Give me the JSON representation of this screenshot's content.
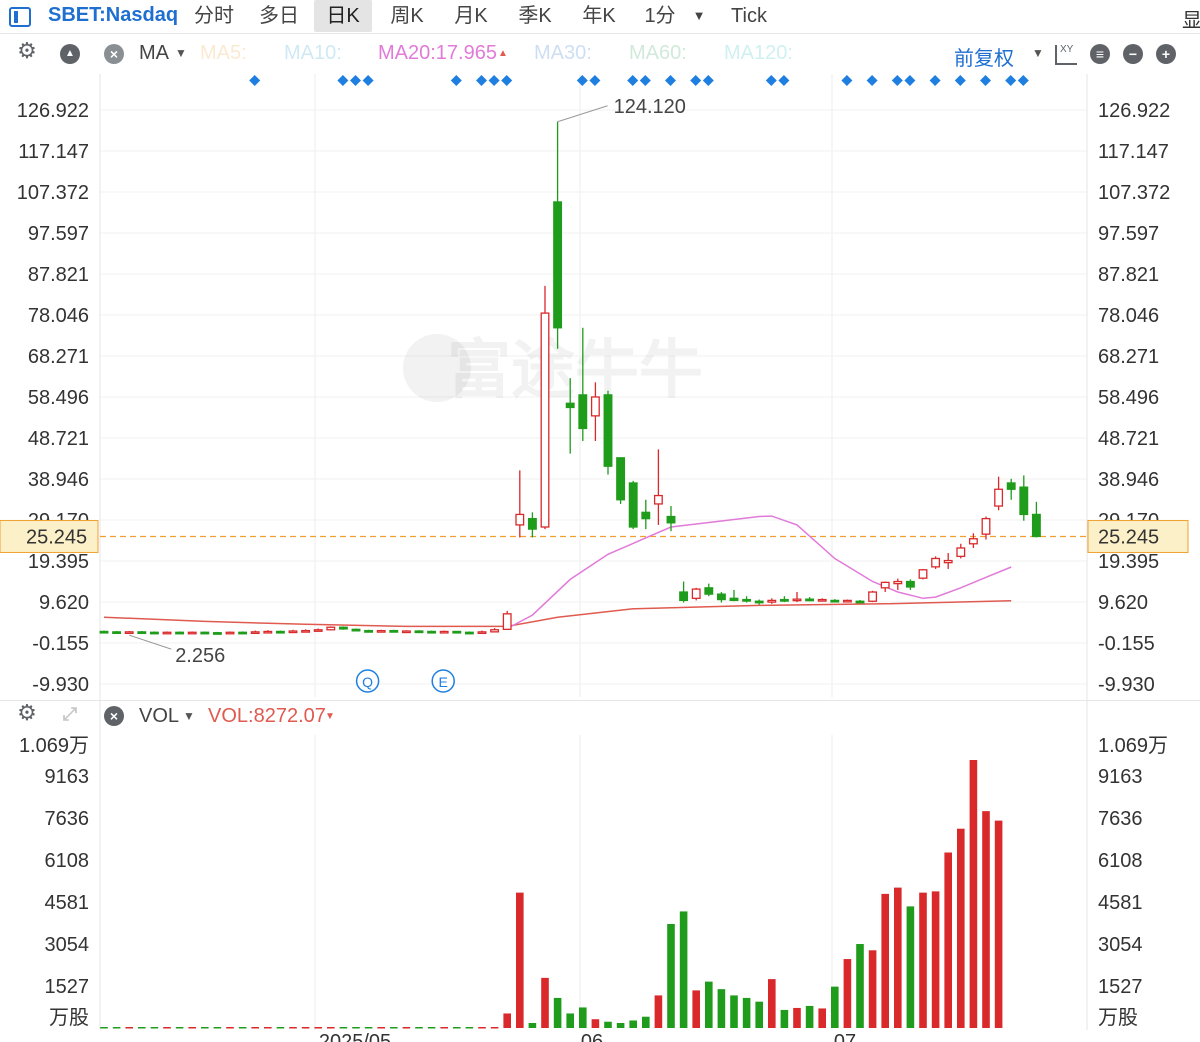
{
  "toolbar": {
    "ticker": "SBET:Nasdaq",
    "tabs": [
      "分时",
      "多日",
      "日K",
      "周K",
      "月K",
      "季K",
      "年K",
      "1分",
      "Tick"
    ],
    "active_tab": "日K",
    "right_cut": "显"
  },
  "ma_bar": {
    "indicator": "MA",
    "ma5": "MA5:",
    "ma10": "MA10:",
    "ma20": "MA20:17.965",
    "ma30": "MA30:",
    "ma60": "MA60:",
    "ma120": "MA120:",
    "adjust": "前复权",
    "xy_label": "XY"
  },
  "vol_bar": {
    "indicator": "VOL",
    "value": "VOL:8272.07"
  },
  "watermark": "富途牛牛",
  "colors": {
    "up": "#d9292b",
    "down": "#1f9c1b",
    "ma20": "#e27ad9",
    "ma_long": "#e05a4f",
    "accent": "#1f6fd1",
    "current": "#f0a030",
    "current_bg": "#fbf0c8",
    "marker": "#1e7fe0"
  },
  "chart_data": [
    {
      "type": "candlestick",
      "title": "SBET:Nasdaq 日K",
      "y_ticks": [
        "126.922",
        "117.147",
        "107.372",
        "97.597",
        "87.821",
        "78.046",
        "68.271",
        "58.496",
        "48.721",
        "38.946",
        "29.170",
        "19.395",
        "9.620",
        "-0.155",
        "-9.930"
      ],
      "ylim": [
        -9.93,
        126.922
      ],
      "x_labels": [
        "2025/05",
        "06",
        "07"
      ],
      "current_price": "25.245",
      "high_label": "124.120",
      "low_label": "2.256",
      "event_markers": [
        "Q",
        "E"
      ],
      "candles": [
        {
          "o": 2.6,
          "c": 2.5,
          "h": 2.8,
          "l": 2.3
        },
        {
          "o": 2.5,
          "c": 2.4,
          "h": 2.7,
          "l": 2.3
        },
        {
          "o": 2.4,
          "c": 2.5,
          "h": 2.7,
          "l": 2.2
        },
        {
          "o": 2.5,
          "c": 2.4,
          "h": 2.7,
          "l": 2.3
        },
        {
          "o": 2.4,
          "c": 2.3,
          "h": 2.6,
          "l": 2.2
        },
        {
          "o": 2.3,
          "c": 2.4,
          "h": 2.6,
          "l": 2.2
        },
        {
          "o": 2.4,
          "c": 2.3,
          "h": 2.6,
          "l": 2.2
        },
        {
          "o": 2.3,
          "c": 2.4,
          "h": 2.6,
          "l": 2.2
        },
        {
          "o": 2.4,
          "c": 2.3,
          "h": 2.6,
          "l": 2.2
        },
        {
          "o": 2.3,
          "c": 2.256,
          "h": 2.5,
          "l": 2.256
        },
        {
          "o": 2.3,
          "c": 2.4,
          "h": 2.6,
          "l": 2.2
        },
        {
          "o": 2.4,
          "c": 2.3,
          "h": 2.6,
          "l": 2.2
        },
        {
          "o": 2.3,
          "c": 2.5,
          "h": 2.8,
          "l": 2.2
        },
        {
          "o": 2.5,
          "c": 2.6,
          "h": 2.9,
          "l": 2.4
        },
        {
          "o": 2.6,
          "c": 2.5,
          "h": 2.8,
          "l": 2.4
        },
        {
          "o": 2.5,
          "c": 2.7,
          "h": 3.0,
          "l": 2.4
        },
        {
          "o": 2.7,
          "c": 2.8,
          "h": 3.1,
          "l": 2.5
        },
        {
          "o": 2.8,
          "c": 3.0,
          "h": 3.3,
          "l": 2.6
        },
        {
          "o": 3.0,
          "c": 3.6,
          "h": 3.8,
          "l": 2.9
        },
        {
          "o": 3.6,
          "c": 3.2,
          "h": 3.8,
          "l": 3.0
        },
        {
          "o": 3.1,
          "c": 2.8,
          "h": 3.3,
          "l": 2.7
        },
        {
          "o": 2.8,
          "c": 2.6,
          "h": 3.0,
          "l": 2.5
        },
        {
          "o": 2.6,
          "c": 2.8,
          "h": 3.0,
          "l": 2.5
        },
        {
          "o": 2.8,
          "c": 2.6,
          "h": 3.0,
          "l": 2.5
        },
        {
          "o": 2.6,
          "c": 2.7,
          "h": 2.9,
          "l": 2.5
        },
        {
          "o": 2.7,
          "c": 2.6,
          "h": 2.9,
          "l": 2.5
        },
        {
          "o": 2.6,
          "c": 2.5,
          "h": 2.8,
          "l": 2.4
        },
        {
          "o": 2.5,
          "c": 2.6,
          "h": 2.8,
          "l": 2.4
        },
        {
          "o": 2.6,
          "c": 2.4,
          "h": 2.7,
          "l": 2.3
        },
        {
          "o": 2.4,
          "c": 2.3,
          "h": 2.6,
          "l": 2.2
        },
        {
          "o": 2.3,
          "c": 2.5,
          "h": 2.8,
          "l": 2.2
        },
        {
          "o": 2.5,
          "c": 3.0,
          "h": 3.4,
          "l": 2.4
        },
        {
          "o": 3.1,
          "c": 6.8,
          "h": 7.5,
          "l": 3.0
        },
        {
          "o": 28.0,
          "c": 30.5,
          "h": 41.0,
          "l": 25.0
        },
        {
          "o": 29.5,
          "c": 27.0,
          "h": 31.0,
          "l": 25.0
        },
        {
          "o": 27.5,
          "c": 78.5,
          "h": 85.0,
          "l": 27.0
        },
        {
          "o": 105.0,
          "c": 75.0,
          "h": 124.12,
          "l": 70.0
        },
        {
          "o": 57.0,
          "c": 56.0,
          "h": 63.0,
          "l": 45.0
        },
        {
          "o": 59.0,
          "c": 51.0,
          "h": 75.0,
          "l": 48.0
        },
        {
          "o": 54.0,
          "c": 58.5,
          "h": 62.0,
          "l": 48.0
        },
        {
          "o": 59.0,
          "c": 42.0,
          "h": 60.0,
          "l": 40.0
        },
        {
          "o": 44.0,
          "c": 34.0,
          "h": 43.5,
          "l": 33.0
        },
        {
          "o": 38.0,
          "c": 27.5,
          "h": 38.5,
          "l": 27.0
        },
        {
          "o": 31.0,
          "c": 29.5,
          "h": 34.0,
          "l": 27.0
        },
        {
          "o": 33.0,
          "c": 35.0,
          "h": 46.0,
          "l": 28.0
        },
        {
          "o": 30.0,
          "c": 28.5,
          "h": 32.5,
          "l": 26.5
        },
        {
          "o": 12.0,
          "c": 10.0,
          "h": 14.5,
          "l": 9.5
        },
        {
          "o": 10.5,
          "c": 12.7,
          "h": 13.0,
          "l": 10.0
        },
        {
          "o": 13.0,
          "c": 11.5,
          "h": 14.0,
          "l": 11.0
        },
        {
          "o": 11.5,
          "c": 10.2,
          "h": 12.0,
          "l": 9.5
        },
        {
          "o": 10.5,
          "c": 10.0,
          "h": 12.5,
          "l": 9.8
        },
        {
          "o": 10.2,
          "c": 10.0,
          "h": 11.0,
          "l": 9.5
        },
        {
          "o": 9.8,
          "c": 9.5,
          "h": 10.2,
          "l": 9.0
        },
        {
          "o": 9.6,
          "c": 10.0,
          "h": 10.5,
          "l": 9.2
        },
        {
          "o": 10.2,
          "c": 10.0,
          "h": 11.0,
          "l": 9.6
        },
        {
          "o": 10.0,
          "c": 10.3,
          "h": 12.0,
          "l": 9.6
        },
        {
          "o": 10.3,
          "c": 10.0,
          "h": 10.8,
          "l": 9.8
        },
        {
          "o": 10.0,
          "c": 10.2,
          "h": 10.5,
          "l": 9.8
        },
        {
          "o": 10.0,
          "c": 9.9,
          "h": 10.3,
          "l": 9.6
        },
        {
          "o": 9.9,
          "c": 10.0,
          "h": 10.2,
          "l": 9.7
        },
        {
          "o": 9.8,
          "c": 9.7,
          "h": 10.1,
          "l": 9.5
        },
        {
          "o": 9.8,
          "c": 12.0,
          "h": 12.3,
          "l": 9.6
        },
        {
          "o": 13.0,
          "c": 14.3,
          "h": 14.5,
          "l": 12.0
        },
        {
          "o": 14.0,
          "c": 14.5,
          "h": 15.2,
          "l": 12.5
        },
        {
          "o": 14.5,
          "c": 13.2,
          "h": 15.0,
          "l": 12.5
        },
        {
          "o": 15.3,
          "c": 17.3,
          "h": 17.5,
          "l": 15.0
        },
        {
          "o": 18.0,
          "c": 20.0,
          "h": 20.5,
          "l": 17.5
        },
        {
          "o": 19.0,
          "c": 19.5,
          "h": 21.3,
          "l": 17.5
        },
        {
          "o": 20.5,
          "c": 22.5,
          "h": 23.5,
          "l": 20.0
        },
        {
          "o": 23.5,
          "c": 24.7,
          "h": 26.0,
          "l": 22.5
        },
        {
          "o": 25.8,
          "c": 29.5,
          "h": 30.0,
          "l": 24.5
        },
        {
          "o": 32.5,
          "c": 36.5,
          "h": 39.5,
          "l": 31.5
        },
        {
          "o": 38.0,
          "c": 36.5,
          "h": 39.0,
          "l": 34.0
        },
        {
          "o": 37.0,
          "c": 30.5,
          "h": 39.8,
          "l": 29.0
        },
        {
          "o": 30.5,
          "c": 25.245,
          "h": 33.5,
          "l": 25.0
        }
      ],
      "ma20": [
        {
          "i": 32,
          "v": 3.3
        },
        {
          "i": 34,
          "v": 6.5
        },
        {
          "i": 37,
          "v": 15.0
        },
        {
          "i": 40,
          "v": 21.0
        },
        {
          "i": 45,
          "v": 27.5
        },
        {
          "i": 52,
          "v": 30.0
        },
        {
          "i": 53,
          "v": 30.1
        },
        {
          "i": 55,
          "v": 28.0
        },
        {
          "i": 58,
          "v": 20.0
        },
        {
          "i": 61,
          "v": 14.5
        },
        {
          "i": 63,
          "v": 12.0
        },
        {
          "i": 65,
          "v": 10.5
        },
        {
          "i": 66,
          "v": 10.8
        },
        {
          "i": 68,
          "v": 13.0
        },
        {
          "i": 70,
          "v": 15.5
        },
        {
          "i": 72,
          "v": 17.965
        }
      ],
      "ma_long": [
        {
          "i": 0,
          "v": 6.0
        },
        {
          "i": 8,
          "v": 5.0
        },
        {
          "i": 16,
          "v": 4.3
        },
        {
          "i": 24,
          "v": 3.8
        },
        {
          "i": 32,
          "v": 3.8
        },
        {
          "i": 36,
          "v": 6.0
        },
        {
          "i": 42,
          "v": 8.0
        },
        {
          "i": 52,
          "v": 8.8
        },
        {
          "i": 62,
          "v": 9.2
        },
        {
          "i": 72,
          "v": 9.9
        }
      ]
    },
    {
      "type": "bar",
      "title": "VOL",
      "ylabel": "万股",
      "y_ticks": [
        "1.069万",
        "9163",
        "7636",
        "6108",
        "4581",
        "3054",
        "1527",
        "万股"
      ],
      "ylim": [
        0,
        10690
      ],
      "values": [
        40,
        40,
        40,
        40,
        40,
        40,
        40,
        40,
        40,
        40,
        40,
        40,
        40,
        40,
        40,
        40,
        40,
        40,
        40,
        40,
        40,
        40,
        40,
        40,
        40,
        40,
        40,
        40,
        40,
        40,
        40,
        40,
        580,
        5400,
        200,
        2000,
        1200,
        580,
        820,
        350,
        250,
        200,
        300,
        450,
        1300,
        4150,
        4650,
        1500,
        1850,
        1550,
        1300,
        1200,
        1050,
        1950,
        720,
        800,
        880,
        780,
        1650,
        2750,
        3350,
        3100,
        5350,
        5600,
        4850,
        5400,
        5450,
        7000,
        7950,
        10690,
        8650,
        8272
      ]
    }
  ]
}
